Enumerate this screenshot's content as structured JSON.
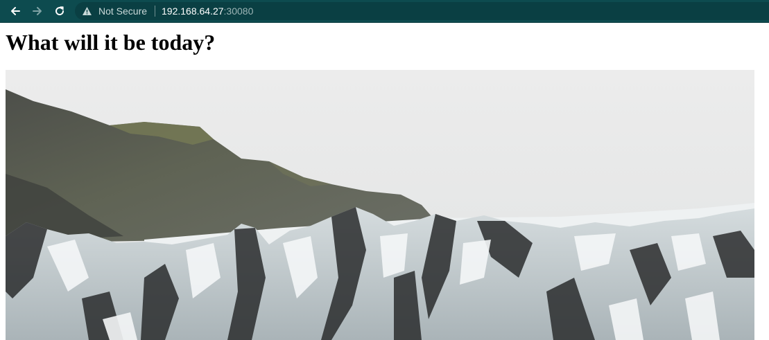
{
  "browser": {
    "security_label": "Not Secure",
    "url_host": "192.168.64.27",
    "url_port": ":30080",
    "toolbar_color": "#0d4b4f"
  },
  "page": {
    "heading": "What will it be today?"
  },
  "image": {
    "subject": "glacier-landscape"
  }
}
